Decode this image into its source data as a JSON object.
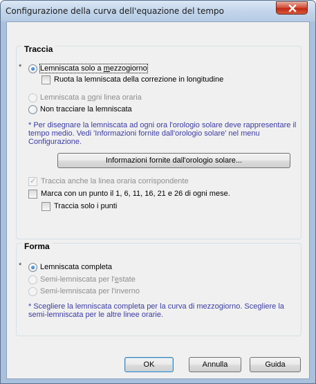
{
  "window": {
    "title": "Configurazione della curva dell'equazione del tempo"
  },
  "traccia": {
    "title": "Traccia",
    "asterisk": "*",
    "solo_mezzogiorno": {
      "before": "Lemniscata solo a ",
      "access": "m",
      "after": "ezzogiorno",
      "checked": true
    },
    "ruota": {
      "label": "Ruota la lemniscata della correzione in longitudine",
      "checked": false
    },
    "ogni_linea": {
      "before": "Lemniscata a ",
      "access": "o",
      "after": "gni linea oraria",
      "checked": false,
      "enabled": false
    },
    "non_tracciare": {
      "label": "Non tracciare la lemniscata",
      "checked": false
    },
    "note_lines": [
      "* Per disegnare la lemniscata ad ogni ora l'orologio solare deve rappresentare il",
      "tempo medio. Vedi 'Informazioni fornite dall'orologio solare' nel menu",
      "Configurazione."
    ],
    "info_button": "Informazioni fornite dall'orologio solare...",
    "traccia_linea": {
      "label": "Traccia anche la linea oraria corrispondente",
      "checked": true,
      "enabled": false
    },
    "marca": {
      "label": "Marca con un punto il 1, 6, 11, 16, 21 e 26 di ogni mese.",
      "checked": false
    },
    "solo_punti": {
      "label": "Traccia solo i punti",
      "checked": false
    }
  },
  "forma": {
    "title": "Forma",
    "asterisk": "*",
    "completa": {
      "label": "Lemniscata completa",
      "checked": true
    },
    "estate": {
      "before": "Semi-lemniscata per l'",
      "access": "e",
      "after": "state",
      "enabled": false
    },
    "inverno": {
      "label": "Semi-lemniscata per l'inverno",
      "enabled": false
    },
    "note_lines": [
      "* Scegliere la lemniscata completa per la curva di mezzogiorno. Scegliere la",
      "semi-lemniscata per le altre linee orarie."
    ]
  },
  "buttons": {
    "ok": "OK",
    "cancel": "Annulla",
    "help": "Guida"
  },
  "icons": {
    "close": "close-icon"
  },
  "colors": {
    "note_text": "#3b3ba3",
    "close_button": "#c02a12"
  }
}
